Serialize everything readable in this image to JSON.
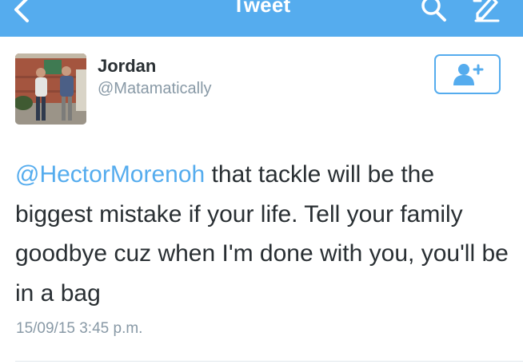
{
  "navbar": {
    "title": "Tweet",
    "back_icon": "chevron-left-icon",
    "search_icon": "search-icon",
    "compose_icon": "compose-tweet-icon",
    "color": "#55acee"
  },
  "user": {
    "name": "Jordan",
    "handle": "@Matamatically",
    "follow_icon": "add-user-icon"
  },
  "tweet": {
    "mention": "@HectorMorenoh",
    "text": " that tackle will be the biggest mistake if your life. Tell your family goodbye cuz when I'm done with you, you'll be in a bag",
    "timestamp": "15/09/15 3:45 p.m."
  },
  "colors": {
    "accent": "#55acee",
    "text": "#292f33",
    "secondary": "#8899a6"
  }
}
